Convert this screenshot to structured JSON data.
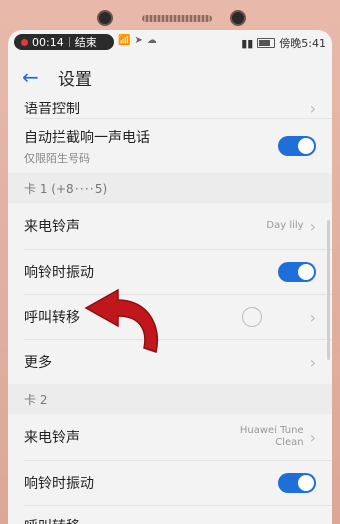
{
  "status_bar": {
    "time_recording": "00:14",
    "end_label": "结束",
    "carrier_time": "傍晚5:41"
  },
  "header": {
    "title": "设置"
  },
  "rows": {
    "voice_control": "语音控制",
    "intercept": {
      "label": "自动拦截响一声电话",
      "sub": "仅限陌生号码"
    },
    "card1_section": "卡 1 (+8 · · · · 5)",
    "card1_ringtone": {
      "label": "来电铃声",
      "value": "Day lily"
    },
    "card1_vibrate": "响铃时振动",
    "card1_forward": "呼叫转移",
    "more": "更多",
    "card2_section": "卡 2",
    "card2_ringtone": {
      "label": "来电铃声",
      "value": "Huawei Tune Clean"
    },
    "card2_vibrate": "响铃时振动",
    "card2_forward": "呼叫转移"
  },
  "toggles": {
    "intercept": true,
    "card1_vibrate": true,
    "card2_vibrate": true
  },
  "colors": {
    "accent": "#1e6fd9",
    "annotation_arrow": "#c0171c"
  }
}
